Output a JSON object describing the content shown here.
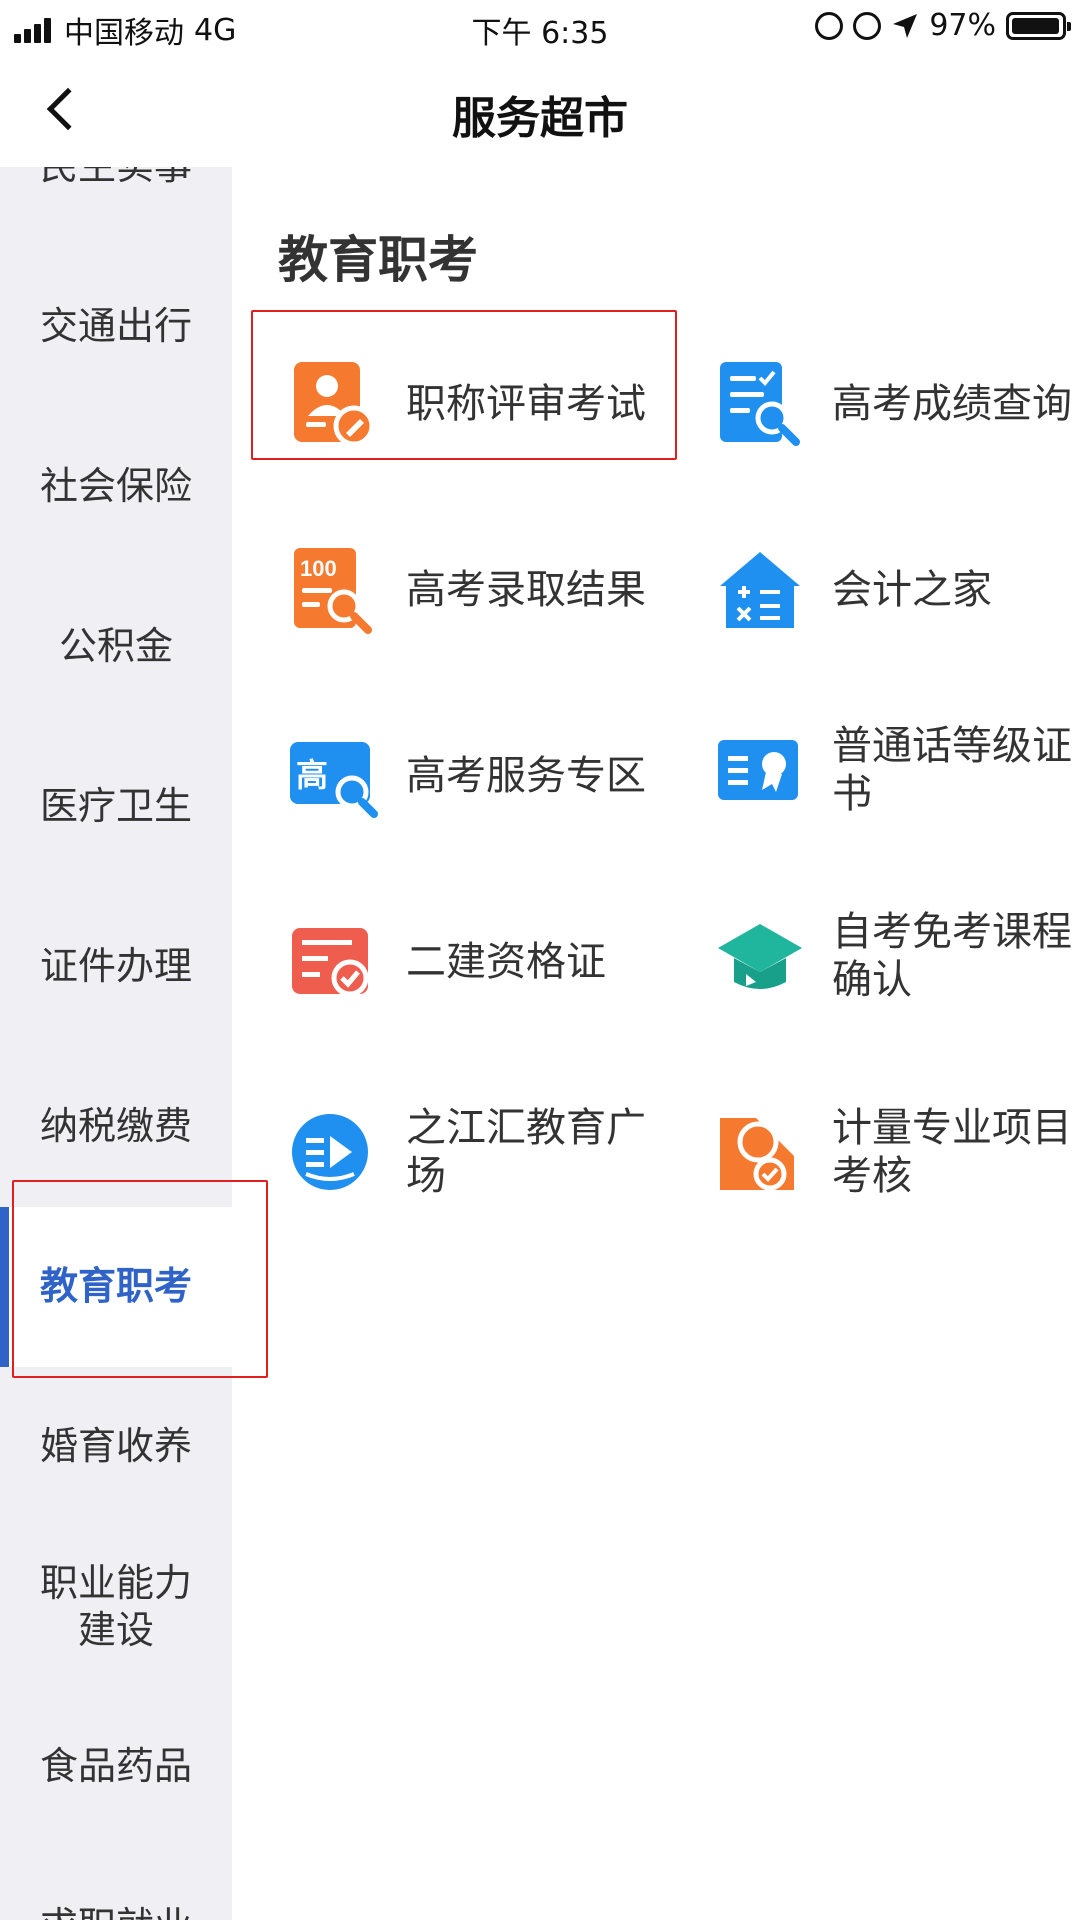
{
  "status_bar": {
    "carrier": "中国移动",
    "network": "4G",
    "time": "下午 6:35",
    "battery": "97%"
  },
  "nav": {
    "title": "服务超市"
  },
  "sidebar": {
    "items": [
      {
        "label": "民生实事"
      },
      {
        "label": "交通出行"
      },
      {
        "label": "社会保险"
      },
      {
        "label": "公积金"
      },
      {
        "label": "医疗卫生"
      },
      {
        "label": "证件办理"
      },
      {
        "label": "纳税缴费"
      },
      {
        "label": "教育职考",
        "active": true
      },
      {
        "label": "婚育收养"
      },
      {
        "label": "职业能力\n建设"
      },
      {
        "label": "食品药品"
      },
      {
        "label": "求职就业"
      }
    ]
  },
  "section": {
    "title": "教育职考"
  },
  "services": [
    {
      "label": "职称评审考试",
      "icon": "person-pen-icon",
      "color": "#f5792f"
    },
    {
      "label": "高考成绩查询",
      "icon": "list-search-icon",
      "color": "#1f8ff0"
    },
    {
      "label": "高考录取结果",
      "icon": "score-100-icon",
      "color": "#f5792f"
    },
    {
      "label": "会计之家",
      "icon": "calc-house-icon",
      "color": "#1f8ff0"
    },
    {
      "label": "高考服务专区",
      "icon": "gao-search-icon",
      "color": "#1f8ff0"
    },
    {
      "label": "普通话等级证书",
      "icon": "certificate-icon",
      "color": "#1f8ff0"
    },
    {
      "label": "二建资格证",
      "icon": "check-doc-icon",
      "color": "#ef5d4e"
    },
    {
      "label": "自考免考课程确认",
      "icon": "grad-cap-icon",
      "color": "#20b59d"
    },
    {
      "label": "之江汇教育广场",
      "icon": "play-book-icon",
      "color": "#1f8ff0"
    },
    {
      "label": "计量专业项目考核",
      "icon": "badge-check-icon",
      "color": "#f5792f"
    }
  ]
}
